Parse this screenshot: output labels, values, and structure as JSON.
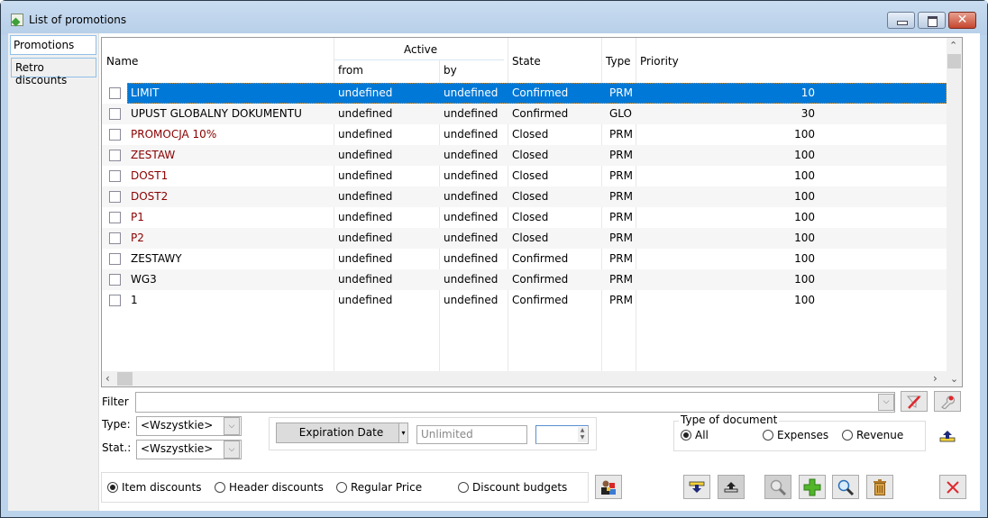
{
  "window": {
    "title": "List of promotions",
    "controls": {
      "minimize": "minimize",
      "maximize": "maximize",
      "close": "✕"
    }
  },
  "side_tabs": [
    {
      "label": "Promotions",
      "active": true
    },
    {
      "label": "Retro discounts",
      "active": false
    }
  ],
  "grid": {
    "columns": {
      "name": "Name",
      "active_group": "Active",
      "from": "from",
      "by": "by",
      "state": "State",
      "type": "Type",
      "priority": "Priority"
    },
    "rows": [
      {
        "name": "LIMIT",
        "from": "undefined",
        "by": "undefined",
        "state": "Confirmed",
        "type": "PRM",
        "priority": "10",
        "selected": true,
        "checked": false,
        "highlight": "normal"
      },
      {
        "name": "UPUST GLOBALNY DOKUMENTU",
        "from": "undefined",
        "by": "undefined",
        "state": "Confirmed",
        "type": "GLO",
        "priority": "30",
        "checked": false,
        "highlight": "normal"
      },
      {
        "name": "PROMOCJA 10%",
        "from": "undefined",
        "by": "undefined",
        "state": "Closed",
        "type": "PRM",
        "priority": "100",
        "checked": false,
        "highlight": "closed"
      },
      {
        "name": "ZESTAW",
        "from": "undefined",
        "by": "undefined",
        "state": "Closed",
        "type": "PRM",
        "priority": "100",
        "checked": false,
        "highlight": "closed"
      },
      {
        "name": "DOST1",
        "from": "undefined",
        "by": "undefined",
        "state": "Closed",
        "type": "PRM",
        "priority": "100",
        "checked": false,
        "highlight": "closed"
      },
      {
        "name": "DOST2",
        "from": "undefined",
        "by": "undefined",
        "state": "Closed",
        "type": "PRM",
        "priority": "100",
        "checked": false,
        "highlight": "closed"
      },
      {
        "name": "P1",
        "from": "undefined",
        "by": "undefined",
        "state": "Closed",
        "type": "PRM",
        "priority": "100",
        "checked": false,
        "highlight": "closed"
      },
      {
        "name": "P2",
        "from": "undefined",
        "by": "undefined",
        "state": "Closed",
        "type": "PRM",
        "priority": "100",
        "checked": false,
        "highlight": "closed"
      },
      {
        "name": "ZESTAWY",
        "from": "undefined",
        "by": "undefined",
        "state": "Confirmed",
        "type": "PRM",
        "priority": "100",
        "checked": false,
        "highlight": "normal"
      },
      {
        "name": "WG3",
        "from": "undefined",
        "by": "undefined",
        "state": "Confirmed",
        "type": "PRM",
        "priority": "100",
        "checked": false,
        "highlight": "normal"
      },
      {
        "name": "1",
        "from": "undefined",
        "by": "undefined",
        "state": "Confirmed",
        "type": "PRM",
        "priority": "100",
        "checked": false,
        "highlight": "normal"
      }
    ],
    "colors": {
      "closed_text": "#8b0000",
      "selection": "#0078d7"
    }
  },
  "filter": {
    "label": "Filter",
    "value": "",
    "type_label": "Type:",
    "type_value": "<Wszystkie>",
    "stat_label": "Stat.:",
    "stat_value": "<Wszystkie>"
  },
  "expiration": {
    "button_label": "Expiration Date",
    "value_placeholder": "Unlimited",
    "spin_value": ""
  },
  "doc_type": {
    "legend": "Type of document",
    "options": [
      {
        "label": "All",
        "selected": true
      },
      {
        "label": "Expenses",
        "selected": false
      },
      {
        "label": "Revenue",
        "selected": false
      }
    ]
  },
  "discount_kind": {
    "options": [
      {
        "label": "Item discounts",
        "selected": true
      },
      {
        "label": "Header discounts",
        "selected": false
      },
      {
        "label": "Regular Price",
        "selected": false
      },
      {
        "label": "Discount budgets",
        "selected": false
      }
    ]
  }
}
